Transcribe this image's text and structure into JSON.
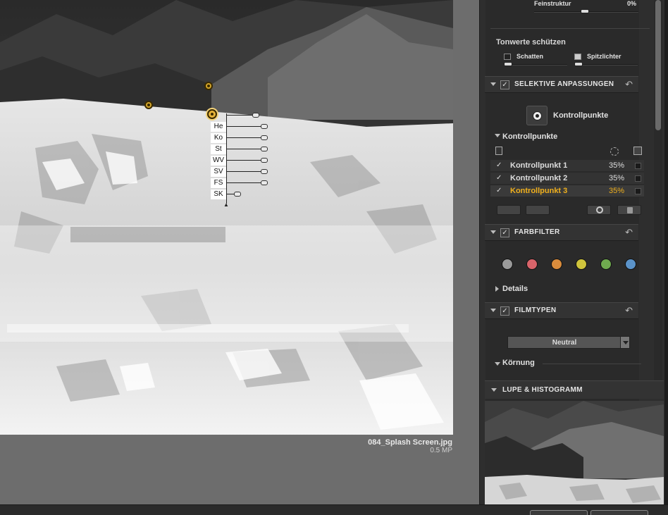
{
  "canvas": {
    "file_name": "084_Splash Screen.jpg",
    "file_mp": "0.5 MP",
    "control_point_sliders": [
      "He",
      "Ko",
      "St",
      "WV",
      "SV",
      "FS",
      "SK"
    ]
  },
  "panel": {
    "feinstruktur": {
      "label": "Feinstruktur",
      "value": "0%"
    },
    "tonwerte": {
      "title": "Tonwerte schützen",
      "shadows": "Schatten",
      "highlights": "Spitzlichter"
    },
    "selective": {
      "title": "SELEKTIVE ANPASSUNGEN",
      "add_button": "Kontrollpunkte",
      "list_title": "Kontrollpunkte",
      "items": [
        {
          "name": "Kontrollpunkt 1",
          "percent": "35%",
          "checked": true,
          "selected": false
        },
        {
          "name": "Kontrollpunkt 2",
          "percent": "35%",
          "checked": true,
          "selected": false
        },
        {
          "name": "Kontrollpunkt 3",
          "percent": "35%",
          "checked": true,
          "selected": true
        }
      ]
    },
    "farbfilter": {
      "title": "FARBFILTER",
      "details": "Details",
      "swatches": [
        "#9a9a9a",
        "#d8646a",
        "#d98c3c",
        "#cfc43c",
        "#6faa4f",
        "#5b93c9"
      ]
    },
    "filmtypen": {
      "title": "FILMTYPEN",
      "selected_film": "Neutral",
      "grain": "Körnung"
    },
    "loupe": {
      "title": "LUPE & HISTOGRAMM"
    }
  },
  "colors": {
    "accent": "#f0b01d",
    "panel_bg": "#2e2e2e",
    "canvas_bg": "#6d6d6d"
  }
}
